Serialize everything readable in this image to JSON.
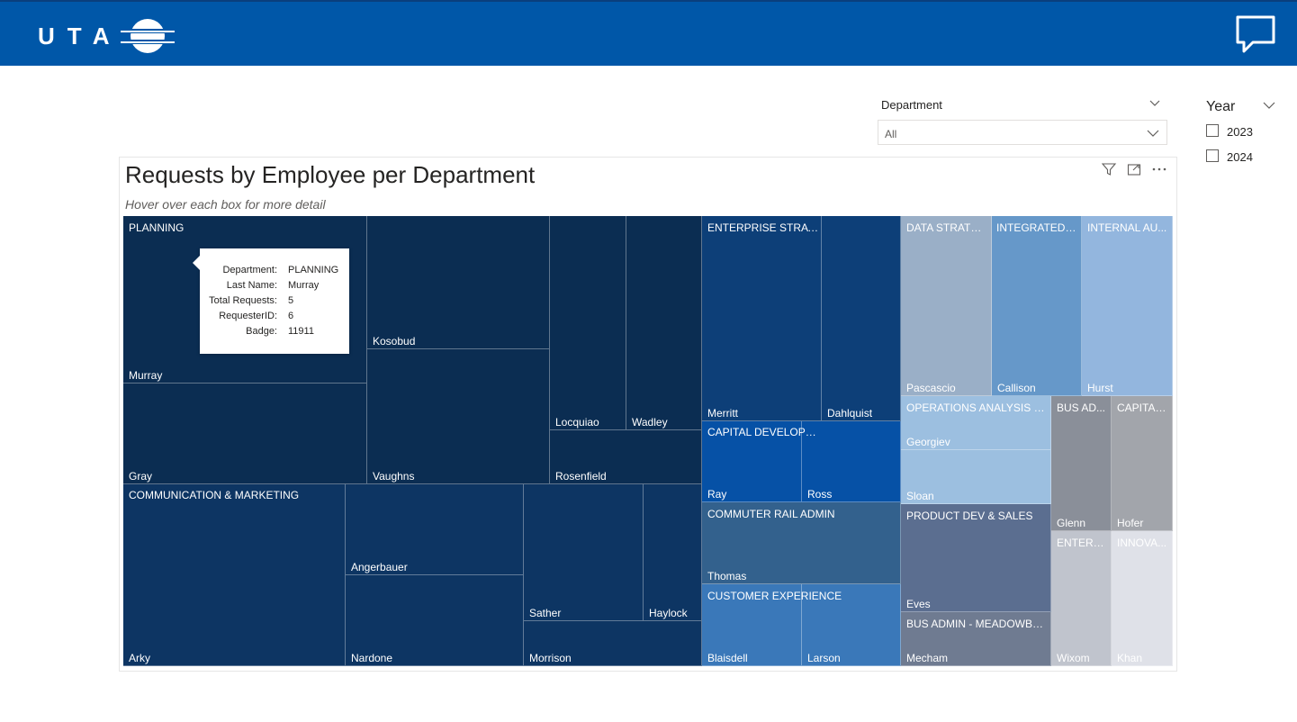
{
  "header": {
    "logo_text": "UTA",
    "background": "#0057a8",
    "chat_icon": "chat-bubble-icon"
  },
  "slicers": {
    "department": {
      "title": "Department",
      "value": "All"
    },
    "year": {
      "title": "Year",
      "options": [
        "2023",
        "2024"
      ]
    }
  },
  "visual": {
    "title": "Requests by Employee per Department",
    "subtitle": "Hover over each box for more detail",
    "tools": [
      "filter-icon",
      "focus-mode-icon",
      "more-options-icon"
    ]
  },
  "tooltip": {
    "rows": [
      {
        "key": "Department:",
        "value": "PLANNING"
      },
      {
        "key": "Last Name:",
        "value": "Murray"
      },
      {
        "key": "Total Requests:",
        "value": "5"
      },
      {
        "key": "RequesterID:",
        "value": "6"
      },
      {
        "key": "Badge:",
        "value": "11911"
      }
    ]
  },
  "chart_data": {
    "type": "treemap",
    "departments": [
      {
        "name": "PLANNING",
        "color": "#0b2d52",
        "employees": [
          "Murray",
          "Gray",
          "Kosobud",
          "Vaughns",
          "Locquiao",
          "Wadley",
          "Rosenfield"
        ]
      },
      {
        "name": "COMMUNICATION & MARKETING",
        "color": "#0d3563",
        "employees": [
          "Arky",
          "Angerbauer",
          "Nardone",
          "Sather",
          "Haylock",
          "Morrison"
        ]
      },
      {
        "name": "ENTERPRISE STRATEGY",
        "color": "#0d3f78",
        "employees": [
          "Merritt",
          "Dahlquist"
        ]
      },
      {
        "name": "CAPITAL DEVELOPMENT",
        "color": "#0651a6",
        "employees": [
          "Ray",
          "Ross"
        ]
      },
      {
        "name": "COMMUTER RAIL ADMIN",
        "color": "#33618d",
        "employees": [
          "Thomas"
        ]
      },
      {
        "name": "CUSTOMER EXPERIENCE",
        "color": "#3a78b9",
        "employees": [
          "Blaisdell",
          "Larson"
        ]
      },
      {
        "name": "DATA STRATEGY",
        "color": "#9aafc7",
        "employees": [
          "Pascascio"
        ]
      },
      {
        "name": "INTEGRATED S...",
        "color": "#6698c9",
        "employees": [
          "Callison"
        ]
      },
      {
        "name": "INTERNAL AU...",
        "color": "#93b6de",
        "employees": [
          "Hurst"
        ]
      },
      {
        "name": "OPERATIONS ANALYSIS & ...",
        "color": "#9cbfe0",
        "employees": [
          "Georgiev",
          "Sloan"
        ]
      },
      {
        "name": "BUS AD...",
        "color": "#8a8f99",
        "employees": [
          "Glenn"
        ]
      },
      {
        "name": "CAPITAL...",
        "color": "#a2a5ab",
        "employees": [
          "Hofer"
        ]
      },
      {
        "name": "PRODUCT DEV & SALES",
        "color": "#5b6e90",
        "employees": [
          "Eves"
        ]
      },
      {
        "name": "BUS ADMIN - MEADOWBR...",
        "color": "#6f7b91",
        "employees": [
          "Mecham"
        ]
      },
      {
        "name": "ENTERP...",
        "color": "#c0c4cd",
        "employees": [
          "Wixom"
        ]
      },
      {
        "name": "INNOVA...",
        "color": "#dfe1e8",
        "employees": [
          "Khan"
        ]
      }
    ]
  }
}
